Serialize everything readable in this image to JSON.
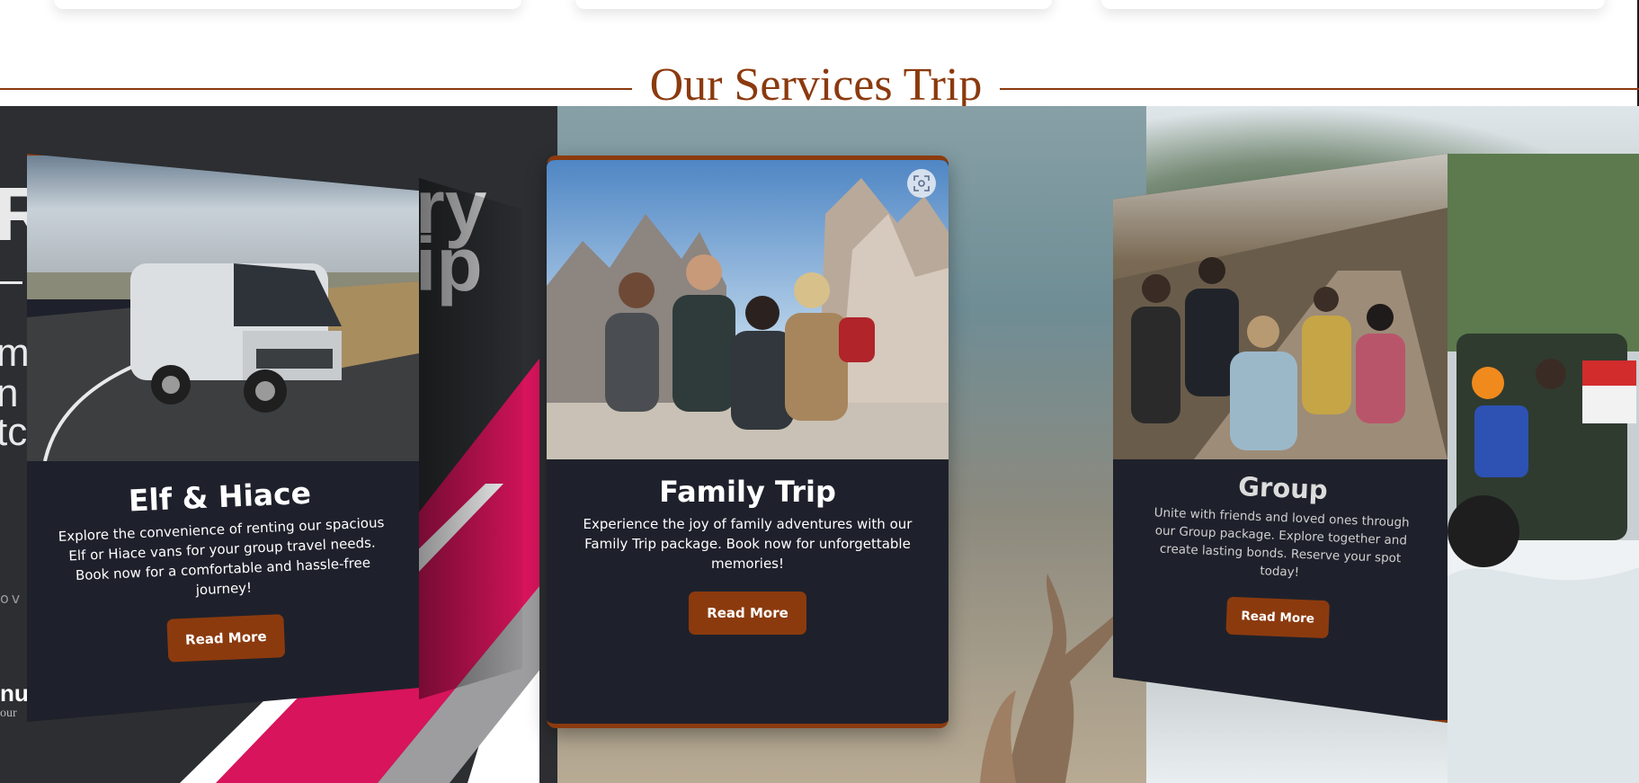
{
  "section": {
    "title": "Our Services Trip"
  },
  "background_brand": {
    "letter_r": "R",
    "word_ry": "ry",
    "word_ip": "ip",
    "line1": "m",
    "line2": "n",
    "line3": "tc",
    "dots": "ov",
    "logo": "nu",
    "logo_sub": "our"
  },
  "cards": [
    {
      "title": "Elf & Hiace",
      "text": "Explore the convenience of renting our spacious Elf or Hiace vans for your group travel needs. Book now for a comfortable and hassle-free journey!",
      "button": "Read More",
      "image_icon": "van-photo"
    },
    {
      "title": "Family Trip",
      "text": "Experience the joy of family adventures with our Family Trip package. Book now for unforgettable memories!",
      "button": "Read More",
      "image_icon": "family-mountain-photo"
    },
    {
      "title": "Group",
      "text": "Unite with friends and loved ones through our Group package. Explore together and create lasting bonds. Reserve your spot today!",
      "button": "Read More",
      "image_icon": "group-hiking-photo"
    }
  ],
  "colors": {
    "accent": "#8b3a0e",
    "card_bg": "#1e212b",
    "brand_pink": "#d7145c"
  }
}
